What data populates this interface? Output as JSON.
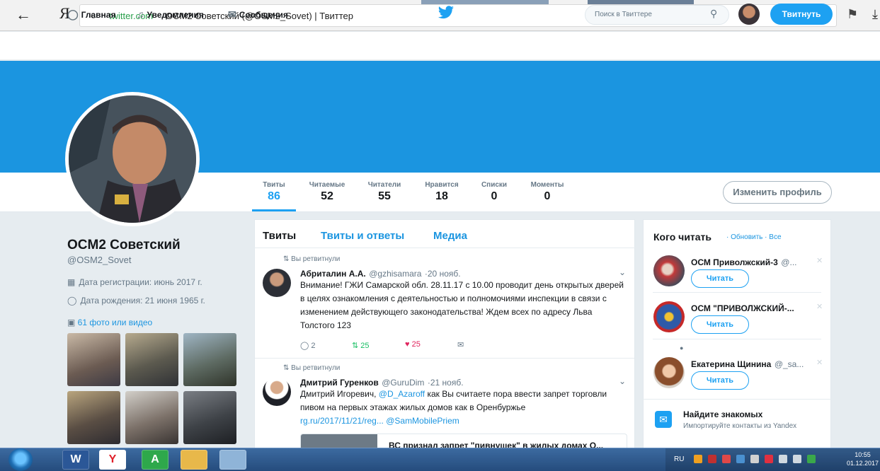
{
  "browser": {
    "back_icon": "←",
    "yandex_logo": "Я",
    "reload_icon": "c",
    "domain": "twitter.com",
    "title": "OCM2 Советский (@OSM2_Sovet) | Твиттер"
  },
  "nav": {
    "home": "Главная",
    "notifications": "Уведомления",
    "messages": "Сообщения",
    "search_placeholder": "Поиск в Твиттере",
    "tweet_button": "Твитнуть"
  },
  "profile_nav": {
    "stats": [
      {
        "label": "Твиты",
        "value": "86"
      },
      {
        "label": "Читаемые",
        "value": "52"
      },
      {
        "label": "Читатели",
        "value": "55"
      },
      {
        "label": "Нравится",
        "value": "18"
      },
      {
        "label": "Списки",
        "value": "0"
      },
      {
        "label": "Моменты",
        "value": "0"
      }
    ],
    "edit_profile": "Изменить профиль"
  },
  "profile": {
    "name": "OCM2 Советский",
    "handle": "@OSM2_Sovet",
    "joined": "Дата регистрации: июнь 2017 г.",
    "birthday": "Дата рождения: 21 июня 1965 г.",
    "photos_link": "61 фото или видео"
  },
  "timeline": {
    "tabs": [
      "Твиты",
      "Твиты и ответы",
      "Медиа"
    ],
    "tweets": [
      {
        "retweet_label": "Вы ретвитнули",
        "name": "Абриталин А.А.",
        "handle": "@gzhisamara",
        "date": "·20 нояб.",
        "text": "Внимание! ГЖИ Самарской обл. 28.11.17 с 10.00 проводит день открытых дверей в целях ознакомления с деятельностью и полномочиями инспекции в связи с изменением действующего законодательства! Ждем всех по адресу Льва Толстого 123",
        "replies": "2",
        "retweets": "25",
        "likes": "25"
      },
      {
        "retweet_label": "Вы ретвитнули",
        "name": "Дмитрий Гуренков",
        "handle": "@GuruDim",
        "date": "·21 нояб.",
        "text_before": "Дмитрий Игоревич,",
        "mention": "@D_Azaroff",
        "text_after": "как Вы считаете пора ввести запрет торговли пивом на первых этажах жилых домов как в Оренбуржье",
        "link": "rg.ru/2017/11/21/reg...",
        "link_mention": "@SamMobilePriem",
        "card_title": "ВС признал запрет \"пивнушек\" в жилых домах О..."
      }
    ]
  },
  "who_to_follow": {
    "title": "Кого читать",
    "links": "· Обновить · Все",
    "follow_label": "Читать",
    "accounts": [
      {
        "name": "ОСМ Приволжский-3",
        "handle": "@..."
      },
      {
        "name": "ОСМ \"ПРИВОЛЖСКИЙ-...",
        "handle": ""
      },
      {
        "name": "Екатерина Щинина",
        "handle": "@_sa..."
      }
    ],
    "find_friends_title": "Найдите знакомых",
    "find_friends_sub": "Импортируйте контакты из Yandex"
  },
  "taskbar": {
    "lang": "RU",
    "time": "10:55",
    "date": "01.12.2017",
    "apps": [
      "W",
      "Y",
      "A",
      "",
      ""
    ]
  }
}
